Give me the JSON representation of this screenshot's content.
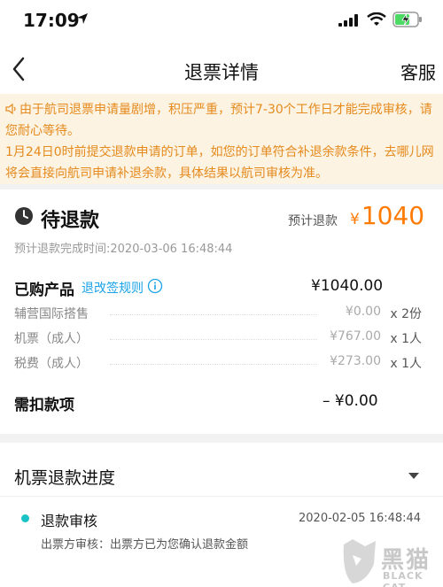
{
  "status_bar": {
    "time": "17:09"
  },
  "nav": {
    "title": "退票详情",
    "right": "客服"
  },
  "notice": {
    "line1": "由于航司退票申请量剧增，积压严重，预计7-30个工作日才能完成审核，请您耐心等待。",
    "line2": "1月24日0时前提交退款申请的订单，如您的订单符合补退余款条件，去哪儿网将会直接向航司申请补退余款，具体结果以航司审核为准。"
  },
  "refund": {
    "status": "待退款",
    "est_label": "预计退款",
    "currency": "¥",
    "est_amount": "1040",
    "est_time": "预计退款完成时间:2020-03-06 16:48:44"
  },
  "bought": {
    "label": "已购产品",
    "rule_link": "退改签规则",
    "amount": "¥1040.00"
  },
  "items": [
    {
      "name": "辅营国际搭售",
      "price": "¥0.00",
      "qty": "x 2份"
    },
    {
      "name": "机票（成人）",
      "price": "¥767.00",
      "qty": "x 1人"
    },
    {
      "name": "税费（成人）",
      "price": "¥273.00",
      "qty": "x 1人"
    }
  ],
  "deduct": {
    "label": "需扣款项",
    "amount": "– ¥0.00"
  },
  "progress": {
    "title": "机票退款进度",
    "step_title": "退款审核",
    "step_time": "2020-02-05 16:48:44",
    "step_desc": "出票方审核：出票方已为您确认退款金额"
  },
  "watermark": {
    "text1": "黑猫",
    "text2": "BLACK CAT"
  },
  "colors": {
    "accent": "#ff7a00",
    "link": "#1aa3e8",
    "notice_bg": "#fcf3e3",
    "notice_text": "#e58a1c",
    "step_dot": "#19c2c6"
  }
}
